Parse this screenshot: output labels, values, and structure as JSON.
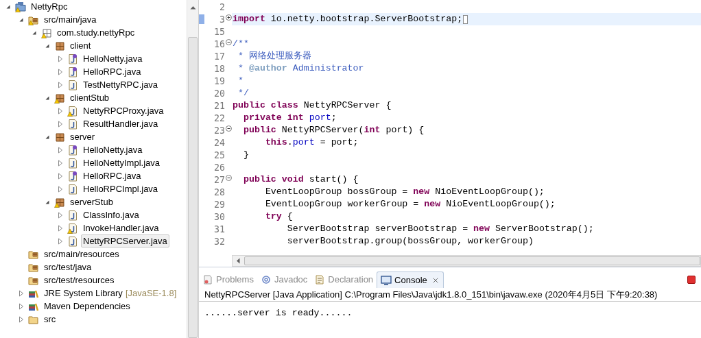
{
  "tree": [
    {
      "label": "NettyRpc",
      "kind": "project",
      "warning": true,
      "expanded": true,
      "selected": false,
      "children": [
        {
          "label": "src/main/java",
          "kind": "source-folder",
          "warning": true,
          "expanded": true,
          "selected": false,
          "children": [
            {
              "label": "com.study.nettyRpc",
              "kind": "package-outline",
              "warning": true,
              "expanded": true,
              "selected": false,
              "children": [
                {
                  "label": "client",
                  "kind": "package",
                  "warning": false,
                  "expanded": true,
                  "selected": false,
                  "children": [
                    {
                      "label": "HelloNetty.java",
                      "kind": "interface",
                      "warning": false,
                      "expanded": false,
                      "selected": false
                    },
                    {
                      "label": "HelloRPC.java",
                      "kind": "interface",
                      "warning": false,
                      "expanded": false,
                      "selected": false
                    },
                    {
                      "label": "TestNettyRPC.java",
                      "kind": "class",
                      "warning": false,
                      "expanded": false,
                      "selected": false
                    }
                  ]
                },
                {
                  "label": "clientStub",
                  "kind": "package",
                  "warning": true,
                  "expanded": true,
                  "selected": false,
                  "children": [
                    {
                      "label": "NettyRPCProxy.java",
                      "kind": "class",
                      "warning": true,
                      "expanded": false,
                      "selected": false
                    },
                    {
                      "label": "ResultHandler.java",
                      "kind": "class",
                      "warning": false,
                      "expanded": false,
                      "selected": false
                    }
                  ]
                },
                {
                  "label": "server",
                  "kind": "package",
                  "warning": false,
                  "expanded": true,
                  "selected": false,
                  "children": [
                    {
                      "label": "HelloNetty.java",
                      "kind": "interface",
                      "warning": false,
                      "expanded": false,
                      "selected": false
                    },
                    {
                      "label": "HelloNettyImpl.java",
                      "kind": "class",
                      "warning": false,
                      "expanded": false,
                      "selected": false
                    },
                    {
                      "label": "HelloRPC.java",
                      "kind": "interface",
                      "warning": false,
                      "expanded": false,
                      "selected": false
                    },
                    {
                      "label": "HelloRPCImpl.java",
                      "kind": "class",
                      "warning": false,
                      "expanded": false,
                      "selected": false
                    }
                  ]
                },
                {
                  "label": "serverStub",
                  "kind": "package",
                  "warning": true,
                  "expanded": true,
                  "selected": false,
                  "children": [
                    {
                      "label": "ClassInfo.java",
                      "kind": "class",
                      "warning": false,
                      "expanded": false,
                      "selected": false
                    },
                    {
                      "label": "InvokeHandler.java",
                      "kind": "class",
                      "warning": true,
                      "expanded": false,
                      "selected": false
                    },
                    {
                      "label": "NettyRPCServer.java",
                      "kind": "class",
                      "warning": false,
                      "expanded": false,
                      "selected": true
                    }
                  ]
                }
              ]
            }
          ]
        },
        {
          "label": "src/main/resources",
          "kind": "source-folder",
          "warning": false,
          "selected": false
        },
        {
          "label": "src/test/java",
          "kind": "source-folder",
          "warning": false,
          "selected": false
        },
        {
          "label": "src/test/resources",
          "kind": "source-folder",
          "warning": false,
          "selected": false
        },
        {
          "label": "JRE System Library",
          "decoration": "[JavaSE-1.8]",
          "kind": "library",
          "warning": false,
          "expanded": false,
          "selected": false
        },
        {
          "label": "Maven Dependencies",
          "kind": "library",
          "warning": false,
          "expanded": false,
          "selected": false
        },
        {
          "label": "src",
          "kind": "folder",
          "warning": false,
          "expanded": false,
          "selected": false
        }
      ]
    }
  ],
  "editor": {
    "lines": [
      {
        "number": "2",
        "current": false
      },
      {
        "number": "3",
        "expanded": false,
        "current": true,
        "tokens": [
          {
            "kind": "kw",
            "text": "import"
          },
          {
            "kind": "plain",
            "text": " io.netty.bootstrap.ServerBootstrap;"
          }
        ]
      },
      {
        "number": "15",
        "current": false
      },
      {
        "number": "16",
        "expanded": true,
        "current": false,
        "tokens": [
          {
            "kind": "comment",
            "text": "/**"
          }
        ]
      },
      {
        "number": "17",
        "current": false,
        "tokens": [
          {
            "kind": "comment",
            "text": " * 网络处理服务器"
          }
        ]
      },
      {
        "number": "18",
        "current": false,
        "tokens": [
          {
            "kind": "comment",
            "text": " * "
          },
          {
            "kind": "tag",
            "text": "@author"
          },
          {
            "kind": "comment",
            "text": " Administrator"
          }
        ]
      },
      {
        "number": "19",
        "current": false,
        "tokens": [
          {
            "kind": "comment",
            "text": " *"
          }
        ]
      },
      {
        "number": "20",
        "current": false,
        "tokens": [
          {
            "kind": "comment",
            "text": " */"
          }
        ]
      },
      {
        "number": "21",
        "current": false,
        "tokens": [
          {
            "kind": "kw",
            "text": "public class"
          },
          {
            "kind": "plain",
            "text": " NettyRPCServer {"
          }
        ]
      },
      {
        "number": "22",
        "current": false,
        "tokens": [
          {
            "kind": "kw",
            "text": "  private int "
          },
          {
            "kind": "field",
            "text": "port"
          },
          {
            "kind": "plain",
            "text": ";"
          }
        ]
      },
      {
        "number": "23",
        "expanded": true,
        "current": false,
        "tokens": [
          {
            "kind": "kw",
            "text": "  public"
          },
          {
            "kind": "plain",
            "text": " NettyRPCServer("
          },
          {
            "kind": "kw",
            "text": "int"
          },
          {
            "kind": "plain",
            "text": " port) {"
          }
        ]
      },
      {
        "number": "24",
        "current": false,
        "tokens": [
          {
            "kind": "kw",
            "text": "      this"
          },
          {
            "kind": "plain",
            "text": "."
          },
          {
            "kind": "field",
            "text": "port"
          },
          {
            "kind": "plain",
            "text": " = port;"
          }
        ]
      },
      {
        "number": "25",
        "current": false,
        "tokens": [
          {
            "kind": "plain",
            "text": "  }"
          }
        ]
      },
      {
        "number": "26",
        "current": false
      },
      {
        "number": "27",
        "expanded": true,
        "current": false,
        "tokens": [
          {
            "kind": "kw",
            "text": "  public void"
          },
          {
            "kind": "plain",
            "text": " start() {"
          }
        ]
      },
      {
        "number": "28",
        "current": false,
        "tokens": [
          {
            "kind": "plain",
            "text": "      EventLoopGroup bossGroup = "
          },
          {
            "kind": "kw",
            "text": "new"
          },
          {
            "kind": "plain",
            "text": " NioEventLoopGroup();"
          }
        ]
      },
      {
        "number": "29",
        "current": false,
        "tokens": [
          {
            "kind": "plain",
            "text": "      EventLoopGroup workerGroup = "
          },
          {
            "kind": "kw",
            "text": "new"
          },
          {
            "kind": "plain",
            "text": " NioEventLoopGroup();"
          }
        ]
      },
      {
        "number": "30",
        "current": false,
        "tokens": [
          {
            "kind": "kw",
            "text": "      try"
          },
          {
            "kind": "plain",
            "text": " {"
          }
        ]
      },
      {
        "number": "31",
        "current": false,
        "tokens": [
          {
            "kind": "plain",
            "text": "          ServerBootstrap serverBootstrap = "
          },
          {
            "kind": "kw",
            "text": "new"
          },
          {
            "kind": "plain",
            "text": " ServerBootstrap();"
          }
        ]
      },
      {
        "number": "32",
        "current": false,
        "tokens": [
          {
            "kind": "plain",
            "text": "          serverBootstrap.group(bossGroup, workerGroup)"
          }
        ]
      }
    ]
  },
  "console": {
    "tabs": [
      {
        "label": "Problems",
        "kind": "problems",
        "selected": false
      },
      {
        "label": "Javadoc",
        "kind": "javadoc",
        "selected": false
      },
      {
        "label": "Declaration",
        "kind": "declaration",
        "selected": false
      },
      {
        "label": "Console",
        "kind": "console",
        "selected": true
      }
    ],
    "running": true,
    "title": "NettyRPCServer [Java Application] C:\\Program Files\\Java\\jdk1.8.0_151\\bin\\javaw.exe (2020年4月5日 下午9:20:38)",
    "output": "......server is ready......"
  }
}
